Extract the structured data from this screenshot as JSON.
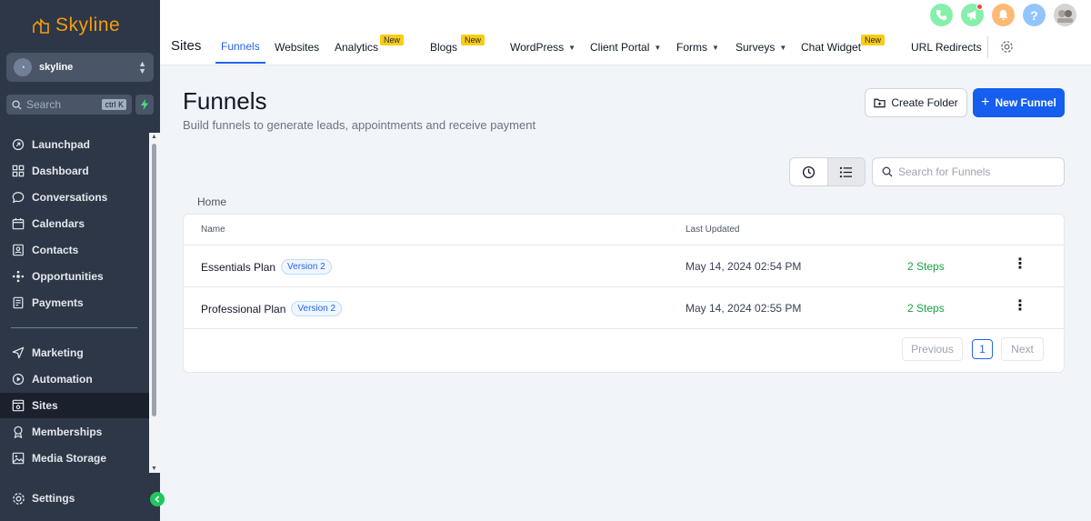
{
  "sidebar": {
    "brand": "Skyline",
    "account": {
      "name": "skyline"
    },
    "search": {
      "placeholder": "Search",
      "shortcut": "ctrl K"
    },
    "items_top": [
      {
        "label": "Launchpad",
        "icon": "rocket-icon"
      },
      {
        "label": "Dashboard",
        "icon": "grid-icon"
      },
      {
        "label": "Conversations",
        "icon": "chat-icon"
      },
      {
        "label": "Calendars",
        "icon": "calendar-icon"
      },
      {
        "label": "Contacts",
        "icon": "contacts-icon"
      },
      {
        "label": "Opportunities",
        "icon": "opportunities-icon"
      },
      {
        "label": "Payments",
        "icon": "payments-icon"
      }
    ],
    "items_bottom": [
      {
        "label": "Marketing",
        "icon": "send-icon"
      },
      {
        "label": "Automation",
        "icon": "automation-icon"
      },
      {
        "label": "Sites",
        "icon": "sites-icon",
        "active": true
      },
      {
        "label": "Memberships",
        "icon": "memberships-icon"
      },
      {
        "label": "Media Storage",
        "icon": "image-icon"
      }
    ],
    "settings_label": "Settings"
  },
  "topbar": {
    "section": "Sites",
    "tabs": [
      {
        "label": "Funnels",
        "active": true
      },
      {
        "label": "Websites"
      },
      {
        "label": "Analytics",
        "badge": "New"
      },
      {
        "label": "Blogs",
        "badge": "New"
      },
      {
        "label": "WordPress",
        "dropdown": true
      },
      {
        "label": "Client Portal",
        "dropdown": true
      },
      {
        "label": "Forms",
        "dropdown": true
      },
      {
        "label": "Surveys",
        "dropdown": true
      },
      {
        "label": "Chat Widget",
        "badge": "New"
      },
      {
        "label": "URL Redirects"
      }
    ],
    "icons": [
      "phone-icon",
      "megaphone-icon",
      "bell-icon",
      "help-icon",
      "user-avatar"
    ]
  },
  "main": {
    "title": "Funnels",
    "subtitle": "Build funnels to generate leads, appointments and receive payment",
    "create_folder": "Create Folder",
    "new_funnel": "New Funnel",
    "search_placeholder": "Search for Funnels",
    "breadcrumb": "Home",
    "table": {
      "headers": {
        "name": "Name",
        "updated": "Last Updated"
      },
      "rows": [
        {
          "name": "Essentials Plan",
          "version": "Version 2",
          "updated": "May 14, 2024 02:54 PM",
          "steps": "2 Steps"
        },
        {
          "name": "Professional Plan",
          "version": "Version 2",
          "updated": "May 14, 2024 02:55 PM",
          "steps": "2 Steps"
        }
      ]
    },
    "pagination": {
      "previous": "Previous",
      "current": "1",
      "next": "Next"
    }
  },
  "colors": {
    "accent": "#155eef",
    "sidebar": "#2d3748",
    "brand": "#f59e0b",
    "steps": "#16a34a",
    "badge": "#facc15"
  }
}
